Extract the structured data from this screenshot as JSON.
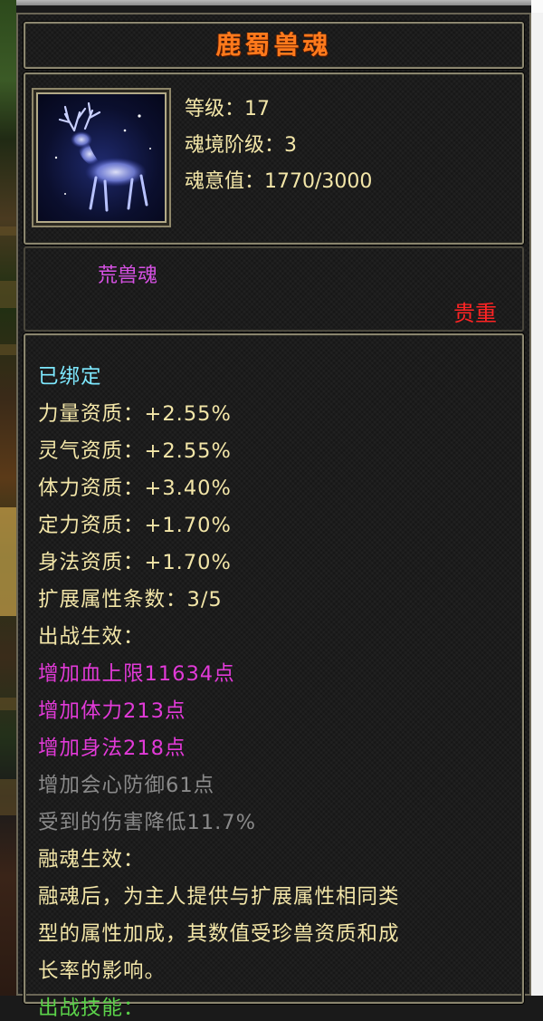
{
  "item": {
    "name": "鹿蜀兽魂",
    "level_line": "等级：17",
    "realm_line": "魂境阶级：3",
    "soul_line": "魂意值：1770/3000",
    "portrait_icon": "deer-spirit-icon",
    "type": "荒兽魂",
    "rarity": "贵重"
  },
  "details": {
    "bound": "已绑定",
    "aptitudes": [
      "力量资质：+2.55%",
      "灵气资质：+2.55%",
      "体力资质：+3.40%",
      "定力资质：+1.70%",
      "身法资质：+1.70%"
    ],
    "ext_count": "扩展属性条数：3/5",
    "battle_header": "出战生效：",
    "battle_active": [
      "增加血上限11634点",
      "增加体力213点",
      "增加身法218点"
    ],
    "battle_inactive": [
      "增加会心防御61点",
      "受到的伤害降低11.7%"
    ],
    "fusion_header": "融魂生效：",
    "fusion_desc": [
      "融魂后，为主人提供与扩展属性相同类",
      "型的属性加成，其数值受珍兽资质和成",
      "长率的影响。"
    ],
    "cut_line": "出战技能："
  },
  "colors": {
    "title": "#ff7a1c",
    "cream": "#f3e6a8",
    "cyan": "#7ee9ff",
    "magenta": "#e23ad8",
    "grey": "#8a8a8a",
    "rarity_red": "#ff2424"
  }
}
